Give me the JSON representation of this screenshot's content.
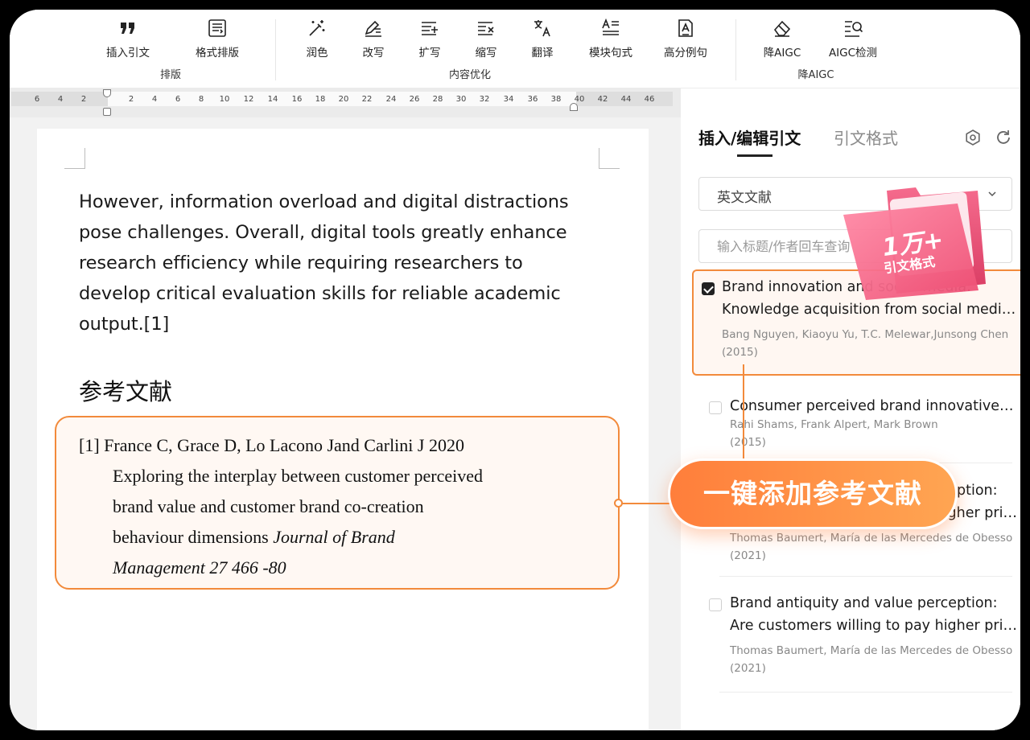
{
  "toolbar": {
    "tools": [
      {
        "label": "插入引文",
        "icon": "quote-icon"
      },
      {
        "label": "格式排版",
        "icon": "format-icon"
      },
      {
        "label": "润色",
        "icon": "magic-wand-icon"
      },
      {
        "label": "改写",
        "icon": "pen-lines-icon"
      },
      {
        "label": "扩写",
        "icon": "expand-lines-icon"
      },
      {
        "label": "缩写",
        "icon": "shrink-lines-icon"
      },
      {
        "label": "翻译",
        "icon": "translate-icon"
      },
      {
        "label": "模块句式",
        "icon": "sentence-template-icon"
      },
      {
        "label": "高分例句",
        "icon": "doc-a-icon"
      },
      {
        "label": "降AIGC",
        "icon": "eraser-icon"
      },
      {
        "label": "AIGC检测",
        "icon": "list-search-icon"
      }
    ],
    "groups": [
      "排版",
      "内容优化",
      "降AIGC"
    ]
  },
  "ruler": {
    "ticks": [
      "6",
      "4",
      "2",
      "2",
      "4",
      "6",
      "8",
      "10",
      "12",
      "14",
      "16",
      "18",
      "20",
      "22",
      "24",
      "26",
      "28",
      "30",
      "32",
      "34",
      "36",
      "38",
      "40",
      "42",
      "44",
      "46"
    ]
  },
  "document": {
    "paragraph": "However, information overload and digital distractions pose challenges. Overall, digital tools greatly enhance research efficiency while requiring researchers to develop critical evaluation skills for reliable academic output.[1]",
    "references_heading": "参考文献",
    "reference": {
      "line1": "[1]  France C, Grace D, Lo Lacono Jand Carlini J 2020",
      "line2": "Exploring the interplay between customer perceived",
      "line3": "brand value and customer brand co-creation",
      "line4_plain": "behaviour dimensions ",
      "line4_italic": "Journal of  Brand",
      "line5": "Management  27 466 -80"
    }
  },
  "panel": {
    "tabs": [
      "插入/编辑引文",
      "引文格式"
    ],
    "select_value": "英文文献",
    "search_placeholder": "输入标题/作者回车查询",
    "items": [
      {
        "title1": "Brand innovation and social media:",
        "title2": "Knowledge acquisition from social media marketing",
        "authors": "Bang Nguyen, Kiaoyu Yu, T.C. Melewar,Junsong Chen",
        "year": "(2015)",
        "checked": true
      },
      {
        "title1": "Consumer perceived brand innovativeness and brand loyalty",
        "title2": "",
        "authors": "Rahi Shams, Frank Alpert, Mark Brown",
        "year": "(2015)",
        "checked": false
      },
      {
        "title1": "Brand antiquity and value perception:",
        "title2": "Are customers willing to pay higher prices",
        "authors": "Thomas Baumert, María de las Mercedes de Obesso",
        "year": "(2021)",
        "checked": false
      },
      {
        "title1": "Brand antiquity and value perception:",
        "title2": "Are customers willing to pay higher prices",
        "authors": "Thomas Baumert, María de las Mercedes de Obesso",
        "year": "(2021)",
        "checked": false
      }
    ]
  },
  "overlay": {
    "cta_label": "一键添加参考文献",
    "badge_line1": "1万+",
    "badge_line2": "引文格式"
  },
  "colors": {
    "accent": "#f28a3b",
    "cta_start": "#ff7e3b",
    "cta_end": "#ffa552",
    "badge_pink": "#f25d7f"
  }
}
